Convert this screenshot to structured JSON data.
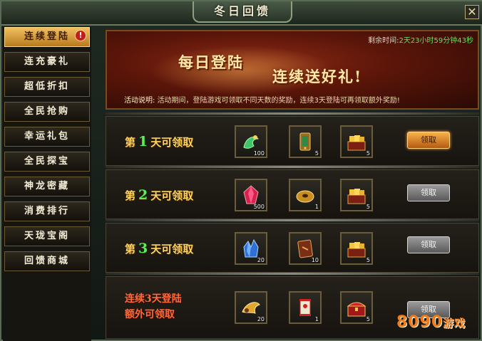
{
  "window": {
    "title": "冬日回馈",
    "close_glyph": "✕"
  },
  "sidebar": {
    "items": [
      {
        "label": "连续登陆",
        "active": true,
        "alert": "!"
      },
      {
        "label": "连充豪礼",
        "active": false
      },
      {
        "label": "超低折扣",
        "active": false
      },
      {
        "label": "全民抢购",
        "active": false
      },
      {
        "label": "幸运礼包",
        "active": false
      },
      {
        "label": "全民探宝",
        "active": false
      },
      {
        "label": "神龙密藏",
        "active": false
      },
      {
        "label": "消费排行",
        "active": false
      },
      {
        "label": "天珑宝阁",
        "active": false
      },
      {
        "label": "回馈商城",
        "active": false
      }
    ]
  },
  "banner": {
    "headline_left": "每日登陆",
    "headline_right": "连续送好礼!",
    "timer_label": "剩余时间:",
    "timer_value": "2天23小时59分钟43秒",
    "desc_label": "活动说明:",
    "desc_text": "活动期间，登陆游戏可领取不同天数的奖励，连续3天登陆可再领取额外奖励!"
  },
  "rows": [
    {
      "title_prefix": "第",
      "title_num": "1",
      "title_suffix": "天可领取",
      "items": [
        {
          "icon": "jade-dragon-icon",
          "count": "100"
        },
        {
          "icon": "treasure-plaque-icon",
          "count": "5"
        },
        {
          "icon": "gold-ingot-chest-icon",
          "count": "5"
        }
      ],
      "button": {
        "label": "领取",
        "state": "active"
      }
    },
    {
      "title_prefix": "第",
      "title_num": "2",
      "title_suffix": "天可领取",
      "items": [
        {
          "icon": "red-crystal-icon",
          "count": "500"
        },
        {
          "icon": "gold-coin-icon",
          "count": "1"
        },
        {
          "icon": "gold-ingot-chest-icon",
          "count": "5"
        }
      ],
      "button": {
        "label": "领取",
        "state": "disabled"
      }
    },
    {
      "title_prefix": "第",
      "title_num": "3",
      "title_suffix": "天可领取",
      "items": [
        {
          "icon": "blue-crystal-icon",
          "count": "20"
        },
        {
          "icon": "skill-book-icon",
          "count": "10"
        },
        {
          "icon": "gold-ingot-chest-icon",
          "count": "5"
        }
      ],
      "button": {
        "label": "领取",
        "state": "disabled"
      }
    },
    {
      "title_line1": "连续3天登陆",
      "title_line2": "额外可领取",
      "items": [
        {
          "icon": "golden-wing-icon",
          "count": "20"
        },
        {
          "icon": "scroll-icon",
          "count": "1"
        },
        {
          "icon": "red-treasure-chest-icon",
          "count": "5"
        }
      ],
      "button": {
        "label": "领取",
        "state": "disabled"
      }
    }
  ],
  "watermark": {
    "text_num": "8090",
    "text_cn": "游戏"
  },
  "colors": {
    "active_button": "#f7b24a",
    "disabled_button": "#9a9a9a",
    "timer_green": "#67e05a",
    "day_number_green": "#5bf05a",
    "title_gold": "#ffd35a"
  }
}
